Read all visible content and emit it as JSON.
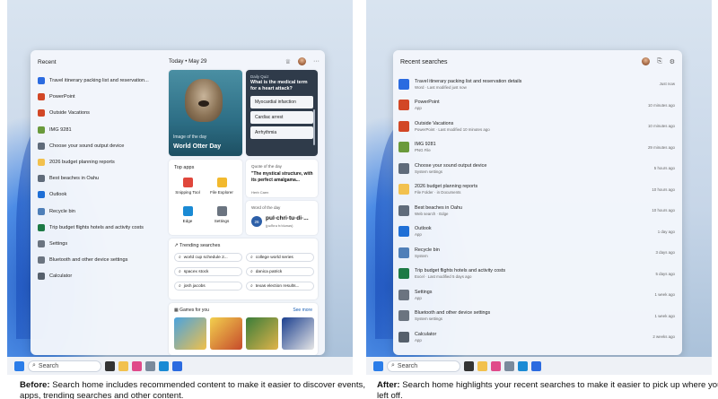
{
  "before": {
    "caption_bold": "Before:",
    "caption_text": " Search home includes recommended content to make it easier to discover events, apps, trending searches and other content.",
    "recent_heading": "Recent",
    "recent_items": [
      {
        "label": "Travel itinerary packing list and reservation...",
        "icon": "word-icon",
        "color": "#2b6be0"
      },
      {
        "label": "PowerPoint",
        "icon": "powerpoint-icon",
        "color": "#d24726"
      },
      {
        "label": "Outside Vacations",
        "icon": "powerpoint-icon",
        "color": "#d24726"
      },
      {
        "label": "IMG 9281",
        "icon": "image-icon",
        "color": "#6a9a3b"
      },
      {
        "label": "Choose your sound output device",
        "icon": "speaker-icon",
        "color": "#5f6b7a"
      },
      {
        "label": "2026 budget planning reports",
        "icon": "folder-icon",
        "color": "#f2c14e"
      },
      {
        "label": "Best beaches in Oahu",
        "icon": "search-icon",
        "color": "#5f6b7a"
      },
      {
        "label": "Outlook",
        "icon": "outlook-icon",
        "color": "#1f6fd6"
      },
      {
        "label": "Recycle bin",
        "icon": "recycle-bin-icon",
        "color": "#4f7fb8"
      },
      {
        "label": "Trip budget flights hotels and activity costs",
        "icon": "excel-icon",
        "color": "#1d7a45"
      },
      {
        "label": "Settings",
        "icon": "gear-icon",
        "color": "#6b7480"
      },
      {
        "label": "Bluetooth and other device settings",
        "icon": "bluetooth-settings-icon",
        "color": "#6b7480"
      },
      {
        "label": "Calculator",
        "icon": "calculator-icon",
        "color": "#56606c"
      }
    ],
    "date_label": "Today • May 29",
    "image_card": {
      "caption": "Image of the day",
      "title": "World Otter Day"
    },
    "quiz": {
      "header": "Daily Quiz",
      "question": "What is the medical term for a heart attack?",
      "options": [
        "Myocardial infarction",
        "Cardiac arrest",
        "Arrhythmia"
      ]
    },
    "top_apps": {
      "title": "Top apps",
      "apps": [
        {
          "label": "Snipping Tool",
          "color": "#e0473c"
        },
        {
          "label": "File Explorer",
          "color": "#f2b92e"
        },
        {
          "label": "Edge",
          "color": "#1a8ad4"
        },
        {
          "label": "Settings",
          "color": "#6b7480"
        }
      ]
    },
    "quote": {
      "header": "Quote of the day",
      "text": "\"The mystical structure, with its perfect amalgama...",
      "author": "Herb Caen"
    },
    "word": {
      "header": "Word of the day",
      "badge": "26",
      "word": "pul·chri·tu·di·...",
      "pron": "(pəl'krə tʊ'dənəs)"
    },
    "trending": {
      "title": "Trending searches",
      "items": [
        "world cup schedule 2...",
        "college world series",
        "spacex stock",
        "danica patrick",
        "josh jacobs",
        "texas election results..."
      ]
    },
    "games": {
      "title": "Games for you",
      "more": "See more"
    },
    "taskbar_search": "Search"
  },
  "after": {
    "caption_bold": "After:",
    "caption_text": " Search home highlights your recent searches to make it easier to pick up where you left off.",
    "heading": "Recent searches",
    "items": [
      {
        "title": "Travel itinerary packing list and reservation details",
        "sub": "Word · Last modified just now",
        "time": "Just now",
        "icon": "word-icon",
        "color": "#2b6be0"
      },
      {
        "title": "PowerPoint",
        "sub": "App",
        "time": "10 minutes ago",
        "icon": "powerpoint-icon",
        "color": "#d24726"
      },
      {
        "title": "Outside Vacations",
        "sub": "PowerPoint · Last modified 10 minutes ago",
        "time": "10 minutes ago",
        "icon": "powerpoint-icon",
        "color": "#d24726"
      },
      {
        "title": "IMG 9281",
        "sub": "PNG File",
        "time": "29 minutes ago",
        "icon": "image-icon",
        "color": "#6a9a3b"
      },
      {
        "title": "Choose your sound output device",
        "sub": "System settings",
        "time": "5 hours ago",
        "icon": "speaker-icon",
        "color": "#5f6b7a"
      },
      {
        "title": "2026 budget planning reports",
        "sub": "File Folder · in Documents",
        "time": "10 hours ago",
        "icon": "folder-icon",
        "color": "#f2c14e"
      },
      {
        "title": "Best beaches in Oahu",
        "sub": "Web search · Edge",
        "time": "10 hours ago",
        "icon": "search-icon",
        "color": "#5f6b7a"
      },
      {
        "title": "Outlook",
        "sub": "App",
        "time": "1 day ago",
        "icon": "outlook-icon",
        "color": "#1f6fd6"
      },
      {
        "title": "Recycle bin",
        "sub": "System",
        "time": "3 days ago",
        "icon": "recycle-bin-icon",
        "color": "#4f7fb8"
      },
      {
        "title": "Trip budget flights hotels and activity costs",
        "sub": "Excel · Last modified 5 days ago",
        "time": "5 days ago",
        "icon": "excel-icon",
        "color": "#1d7a45"
      },
      {
        "title": "Settings",
        "sub": "App",
        "time": "1 week ago",
        "icon": "gear-icon",
        "color": "#6b7480"
      },
      {
        "title": "Bluetooth and other device settings",
        "sub": "System settings",
        "time": "1 week ago",
        "icon": "bluetooth-settings-icon",
        "color": "#6b7480"
      },
      {
        "title": "Calculator",
        "sub": "App",
        "time": "2 weeks ago",
        "icon": "calculator-icon",
        "color": "#56606c"
      }
    ],
    "taskbar_search": "Search"
  }
}
